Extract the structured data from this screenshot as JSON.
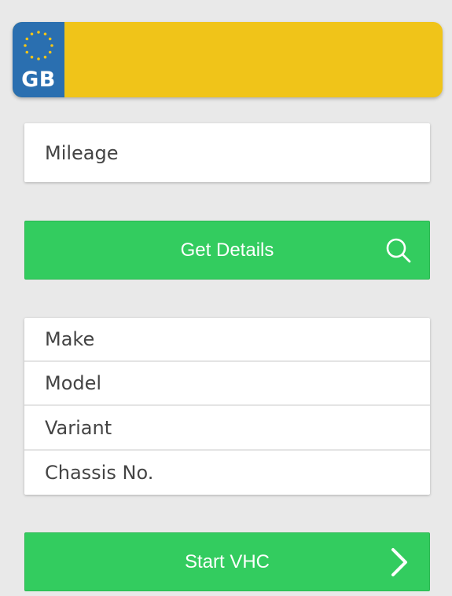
{
  "plate": {
    "country_code": "GB",
    "registration_value": "",
    "band_icon": "eu-stars-icon",
    "colors": {
      "band": "#2a6fb0",
      "plate": "#f0c419",
      "stars": "#f0c419"
    }
  },
  "mileage": {
    "placeholder": "Mileage",
    "value": ""
  },
  "get_details": {
    "label": "Get Details",
    "icon": "search-icon"
  },
  "vehicle_info": {
    "rows": [
      {
        "label": "Make"
      },
      {
        "label": "Model"
      },
      {
        "label": "Variant"
      },
      {
        "label": "Chassis No."
      }
    ]
  },
  "start_vhc": {
    "label": "Start VHC",
    "icon": "chevron-right-icon"
  },
  "colors": {
    "background": "#e9e9e9",
    "button_green": "#33cc5f",
    "card": "#ffffff"
  }
}
